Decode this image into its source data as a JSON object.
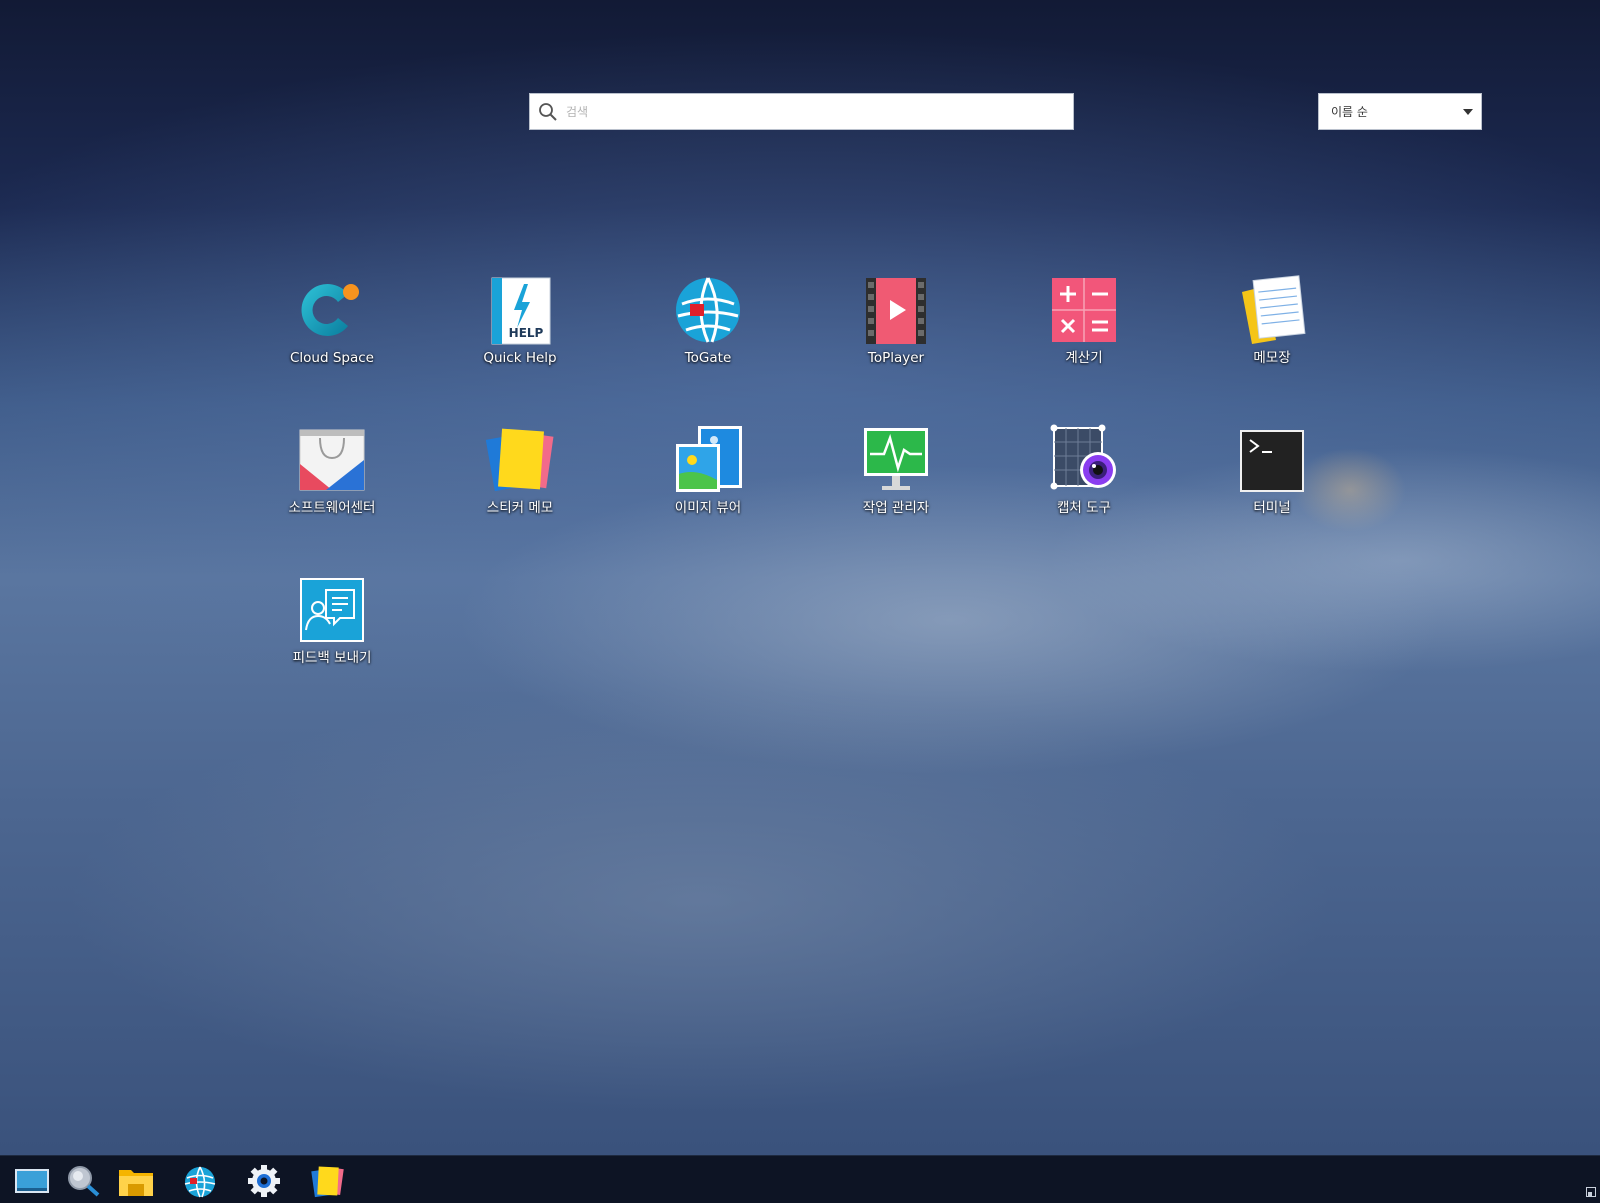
{
  "search": {
    "placeholder": "검색"
  },
  "sort": {
    "selected": "이름 순"
  },
  "apps": [
    {
      "label": "Cloud Space",
      "icon": "cloud-space-icon"
    },
    {
      "label": "Quick Help",
      "icon": "quick-help-icon",
      "icon_text": "HELP"
    },
    {
      "label": "ToGate",
      "icon": "togate-globe-icon"
    },
    {
      "label": "ToPlayer",
      "icon": "toplayer-icon"
    },
    {
      "label": "계산기",
      "icon": "calculator-icon"
    },
    {
      "label": "메모장",
      "icon": "notepad-icon"
    },
    {
      "label": "소프트웨어센터",
      "icon": "software-center-icon"
    },
    {
      "label": "스티커 메모",
      "icon": "sticky-memo-icon"
    },
    {
      "label": "이미지 뷰어",
      "icon": "image-viewer-icon"
    },
    {
      "label": "작업 관리자",
      "icon": "task-manager-icon"
    },
    {
      "label": "캡처 도구",
      "icon": "capture-tool-icon"
    },
    {
      "label": "터미널",
      "icon": "terminal-icon"
    },
    {
      "label": "피드백 보내기",
      "icon": "feedback-icon"
    }
  ],
  "taskbar": {
    "items": [
      "show-desktop-icon",
      "search-icon",
      "file-manager-icon",
      "togate-globe-icon",
      "settings-gear-icon",
      "sticky-memo-icon"
    ]
  },
  "colors": {
    "accent_cyan": "#1aa3d8",
    "toplayer_pink": "#f05a73",
    "calculator_pink": "#f2567a",
    "terminal_bg": "#222222",
    "taskbar_bg": "#0d1424"
  }
}
